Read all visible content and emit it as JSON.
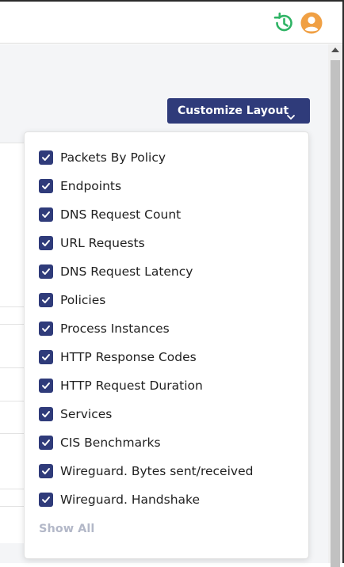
{
  "header": {
    "history_icon": "history-icon",
    "avatar_icon": "user-avatar-icon",
    "history_color": "#2eb364",
    "avatar_color": "#f0a044"
  },
  "customize": {
    "label": "Customize Layout",
    "icon": "chevron-down-icon",
    "color": "#2f3b7a"
  },
  "layout_options": [
    {
      "label": "Packets By Policy",
      "checked": true
    },
    {
      "label": "Endpoints",
      "checked": true
    },
    {
      "label": "DNS Request Count",
      "checked": true
    },
    {
      "label": "URL Requests",
      "checked": true
    },
    {
      "label": "DNS Request Latency",
      "checked": true
    },
    {
      "label": "Policies",
      "checked": true
    },
    {
      "label": "Process Instances",
      "checked": true
    },
    {
      "label": "HTTP Response Codes",
      "checked": true
    },
    {
      "label": "HTTP Request Duration",
      "checked": true
    },
    {
      "label": "Services",
      "checked": true
    },
    {
      "label": "CIS Benchmarks",
      "checked": true
    },
    {
      "label": "Wireguard. Bytes sent/received",
      "checked": true
    },
    {
      "label": "Wireguard. Handshake",
      "checked": true
    }
  ],
  "show_all_label": "Show All"
}
